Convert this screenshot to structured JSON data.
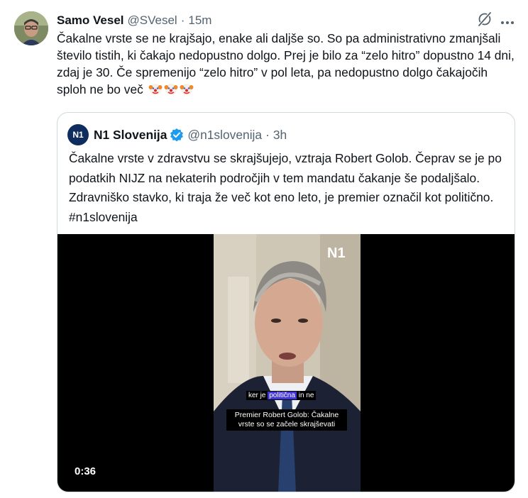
{
  "tweet": {
    "author_name": "Samo Vesel",
    "handle": "@SVesel",
    "separator": "·",
    "time": "15m",
    "text": "Čakalne vrste se ne krajšajo, enake ali daljše so. So pa administrativno zmanjšali število tistih, ki čakajo nedopustno dolgo. Prej je bilo za “zelo hitro” dopustno 14 dni, zdaj je 30. Če spremenijo “zelo hitro” v pol leta, pa nedopustno dolgo čakajočih sploh ne bo več",
    "emoji": [
      "clown-face",
      "clown-face",
      "clown-face"
    ]
  },
  "quote": {
    "author_name": "N1 Slovenija",
    "handle": "@n1slovenija",
    "separator": "·",
    "time": "3h",
    "logo_text": "N1",
    "text": "Čakalne vrste v zdravstvu se skrajšujejo, vztraja Robert Golob. Čeprav se je po podatkih NIJZ na nekaterih področjih v tem mandatu čakanje še podaljšalo. Zdravniško stavko, ki traja že več kot eno leto, je premier označil kot politično. #n1slovenija",
    "video": {
      "watermark": "N1",
      "subtitle_before": "ker je ",
      "subtitle_highlight": "politična",
      "subtitle_after": " in ne",
      "caption": "Premier Robert Golob: Čakalne vrste so se začele skrajševati",
      "duration": "0:36"
    }
  },
  "icons": {
    "grok": "grok-icon",
    "more": "more-icon",
    "verified": "verified-badge-icon"
  },
  "colors": {
    "text": "#0f1419",
    "secondary": "#536471",
    "border": "#cfd9de",
    "verified": "#1d9bf0",
    "highlight": "#3f34d6"
  }
}
